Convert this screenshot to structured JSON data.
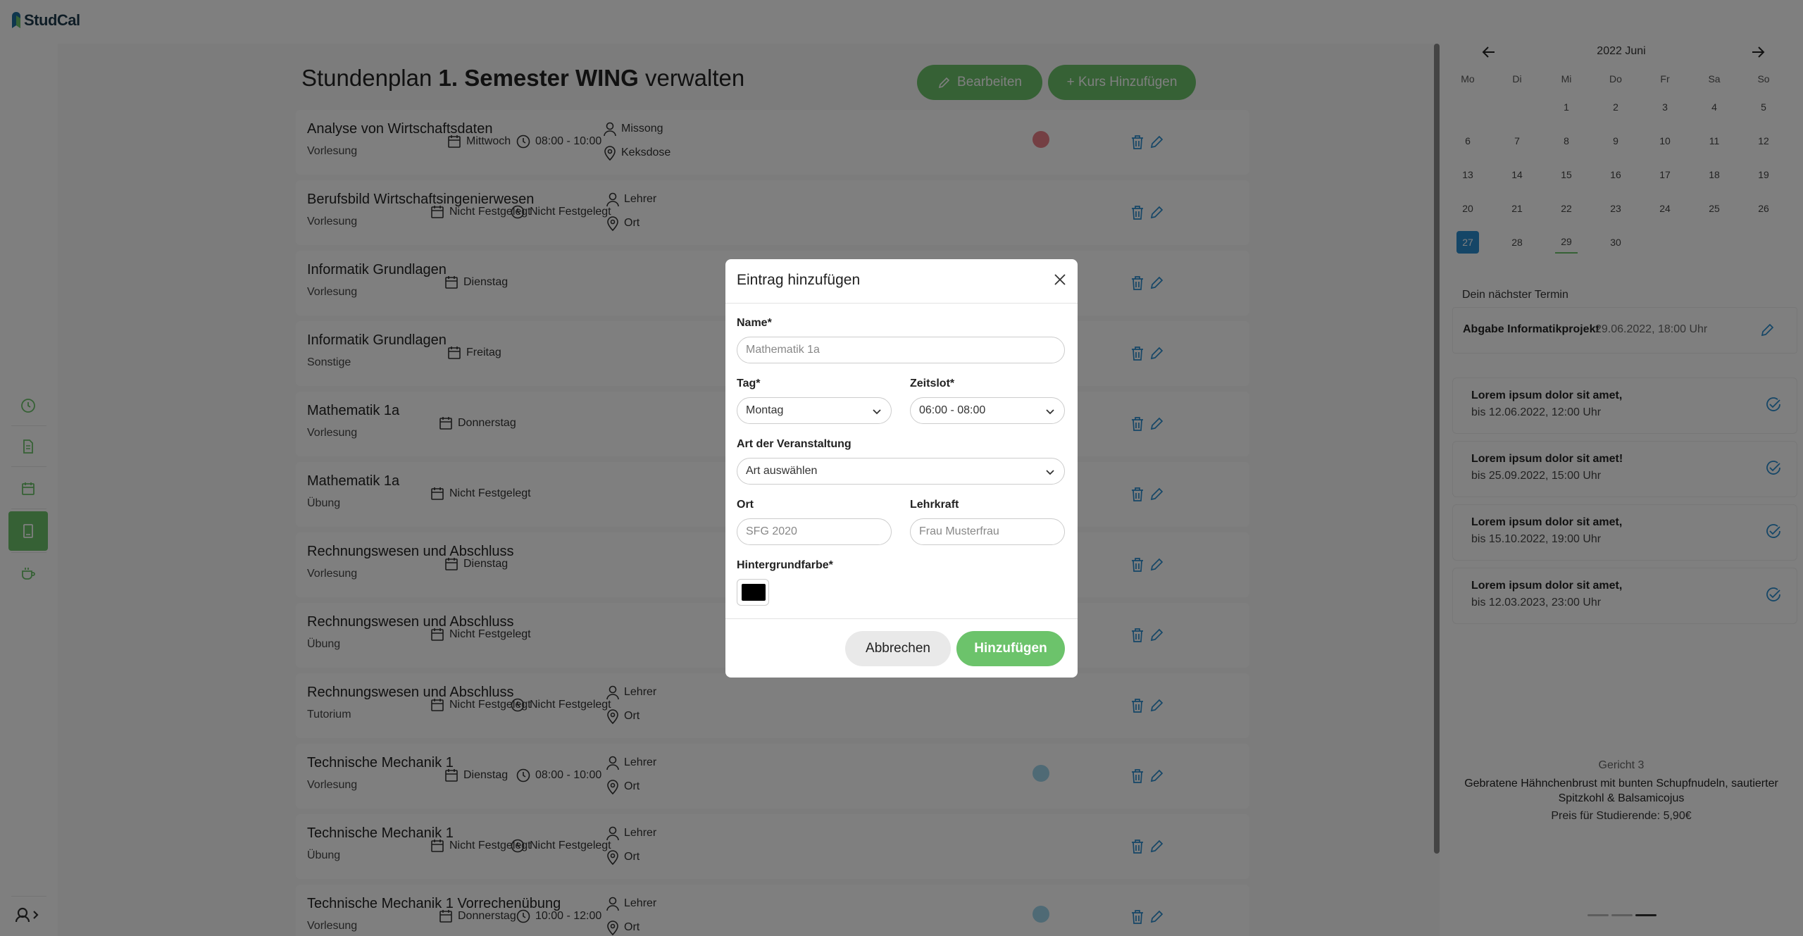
{
  "app": {
    "name": "StudCal"
  },
  "header": {
    "title_prefix": "Stundenplan",
    "title_bold": "1. Semester WING",
    "title_suffix": "verwalten",
    "edit_label": "Bearbeiten",
    "add_course_label": "+ Kurs Hinzufügen"
  },
  "courses": [
    {
      "name": "Analyse von Wirtschaftsdaten",
      "type": "Vorlesung",
      "day": "Mittwoch",
      "time": "08:00 - 10:00",
      "teacher": "Missong",
      "place": "Keksdose",
      "color": "#e87f86"
    },
    {
      "name": "Berufsbild Wirtschaftsingenierwesen",
      "type": "Vorlesung",
      "day": "Nicht Festgelegt",
      "time": "Nicht Festgelegt",
      "teacher": "Lehrer",
      "place": "Ort",
      "color": ""
    },
    {
      "name": "Informatik Grundlagen",
      "type": "Vorlesung",
      "day": "Dienstag",
      "time": "",
      "teacher": "",
      "place": "",
      "color": ""
    },
    {
      "name": "Informatik Grundlagen",
      "type": "Sonstige",
      "day": "Freitag",
      "time": "",
      "teacher": "",
      "place": "",
      "color": ""
    },
    {
      "name": "Mathematik 1a",
      "type": "Vorlesung",
      "day": "Donnerstag",
      "time": "",
      "teacher": "",
      "place": "",
      "color": ""
    },
    {
      "name": "Mathematik 1a",
      "type": "Übung",
      "day": "Nicht Festgelegt",
      "time": "",
      "teacher": "",
      "place": "",
      "color": ""
    },
    {
      "name": "Rechnungswesen und Abschluss",
      "type": "Vorlesung",
      "day": "Dienstag",
      "time": "",
      "teacher": "",
      "place": "",
      "color": ""
    },
    {
      "name": "Rechnungswesen und Abschluss",
      "type": "Übung",
      "day": "Nicht Festgelegt",
      "time": "",
      "teacher": "",
      "place": "",
      "color": ""
    },
    {
      "name": "Rechnungswesen und Abschluss",
      "type": "Tutorium",
      "day": "Nicht Festgelegt",
      "time": "Nicht Festgelegt",
      "teacher": "Lehrer",
      "place": "Ort",
      "color": ""
    },
    {
      "name": "Technische Mechanik 1",
      "type": "Vorlesung",
      "day": "Dienstag",
      "time": "08:00 - 10:00",
      "teacher": "Lehrer",
      "place": "Ort",
      "color": "#9fd4ea"
    },
    {
      "name": "Technische Mechanik 1",
      "type": "Übung",
      "day": "Nicht Festgelegt",
      "time": "Nicht Festgelegt",
      "teacher": "Lehrer",
      "place": "Ort",
      "color": ""
    },
    {
      "name": "Technische Mechanik 1 Vorrechenübung",
      "type": "Vorlesung",
      "day": "Donnerstag",
      "time": "10:00 - 12:00",
      "teacher": "Lehrer",
      "place": "Ort",
      "color": "#9fd4ea"
    }
  ],
  "calendar": {
    "month_label": "2022 Juni",
    "weekdays": [
      "Mo",
      "Di",
      "Mi",
      "Do",
      "Fr",
      "Sa",
      "So"
    ],
    "first_weekday_index": 2,
    "days_in_month": 30,
    "today": 27,
    "marked": [
      29
    ]
  },
  "next_event": {
    "heading": "Dein nächster Termin",
    "name": "Abgabe Informatikprojekt",
    "date": "29.06.2022, 18:00 Uhr"
  },
  "todos": [
    {
      "title": "Lorem ipsum dolor sit amet,",
      "due": "bis 12.06.2022, 12:00 Uhr"
    },
    {
      "title": "Lorem ipsum dolor sit amet!",
      "due": "bis 25.09.2022, 15:00 Uhr"
    },
    {
      "title": "Lorem ipsum dolor sit amet,",
      "due": "bis 15.10.2022, 19:00 Uhr"
    },
    {
      "title": "Lorem ipsum dolor sit amet,",
      "due": "bis 12.03.2023, 23:00 Uhr"
    }
  ],
  "meal": {
    "label": "Gericht 3",
    "description": "Gebratene Hähnchenbrust mit bunten Schupfnudeln, sautierter Spitzkohl & Balsamicojus",
    "price": "Preis für Studierende: 5,90€"
  },
  "modal": {
    "title": "Eintrag hinzufügen",
    "name_label": "Name*",
    "name_placeholder": "Mathematik 1a",
    "day_label": "Tag*",
    "day_value": "Montag",
    "slot_label": "Zeitslot*",
    "slot_value": "06:00 - 08:00",
    "type_label": "Art der Veranstaltung",
    "type_value": "Art auswählen",
    "place_label": "Ort",
    "place_placeholder": "SFG 2020",
    "teacher_label": "Lehrkraft",
    "teacher_placeholder": "Frau Musterfrau",
    "color_label": "Hintergrundfarbe*",
    "color_value": "#000000",
    "cancel_label": "Abbrechen",
    "submit_label": "Hinzufügen"
  },
  "colors": {
    "accent": "#6cc36b",
    "today": "#2a8ccf",
    "icon": "#2a8ccf"
  }
}
